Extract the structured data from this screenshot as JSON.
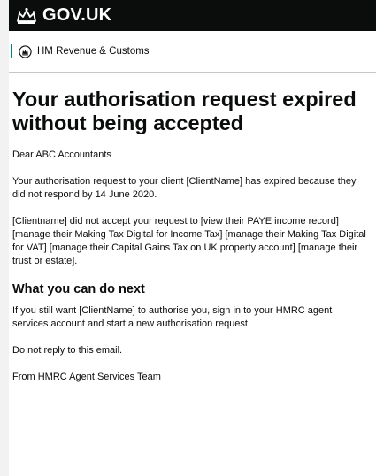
{
  "header": {
    "wordmark": "GOV.UK",
    "logo_icon": "crown-icon"
  },
  "organisation": {
    "name": "HM Revenue & Customs",
    "crest_icon": "hmrc-crest-icon",
    "accent_color": "#00847f"
  },
  "email": {
    "title": "Your authorisation request expired without being accepted",
    "greeting": "Dear ABC Accountants",
    "paragraph_1": "Your authorisation request to your client [ClientName] has expired because they did not respond by 14 June 2020.",
    "paragraph_2": "[Clientname] did not accept your request to [view their PAYE income record] [manage their Making Tax Digital for Income Tax] [manage their Making Tax Digital for VAT] [manage their Capital Gains Tax on UK property account] [manage their trust or estate].",
    "next_heading": "What you can do next",
    "paragraph_3": "If you still want [ClientName] to authorise you, sign in to your HMRC agent services account and start a new authorisation request.",
    "paragraph_4": "Do not reply to this email.",
    "sign_off": "From HMRC Agent Services Team"
  }
}
